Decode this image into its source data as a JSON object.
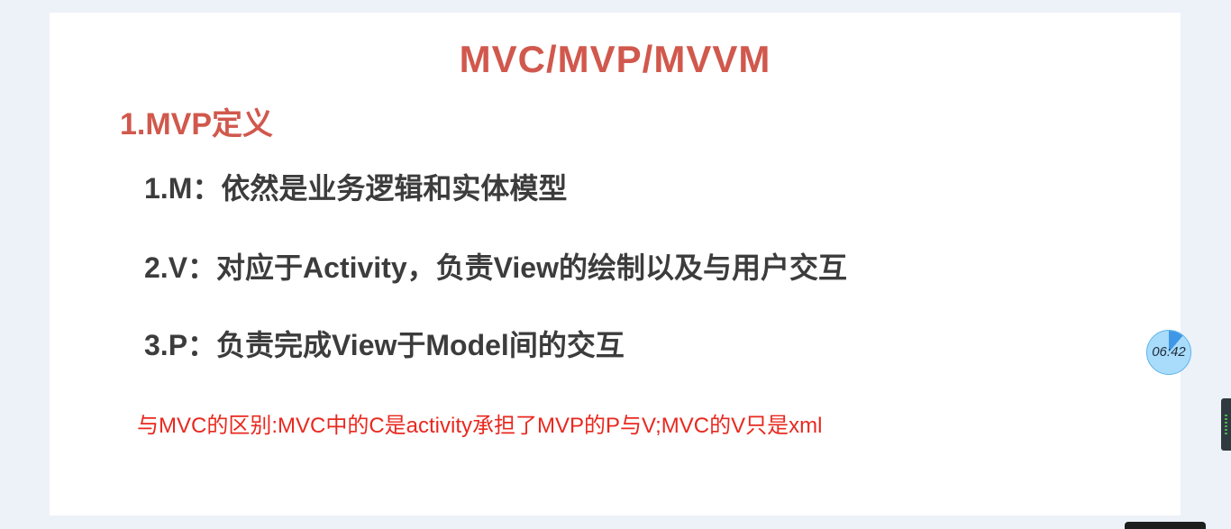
{
  "slide": {
    "title": "MVC/MVP/MVVM",
    "section_heading": "1.MVP定义",
    "points": [
      "1.M：依然是业务逻辑和实体模型",
      "2.V：对应于Activity，负责View的绘制以及与用户交互",
      "3.P：负责完成View于Model间的交互"
    ],
    "note": "与MVC的区别:MVC中的C是activity承担了MVP的P与V;MVC的V只是xml"
  },
  "timer": {
    "time": "06:42"
  },
  "colors": {
    "title": "#d1584d",
    "body_text": "#3c3c3c",
    "note": "#e8291f",
    "timer_fill": "#a9dcfb",
    "timer_progress": "#3f97e6"
  }
}
